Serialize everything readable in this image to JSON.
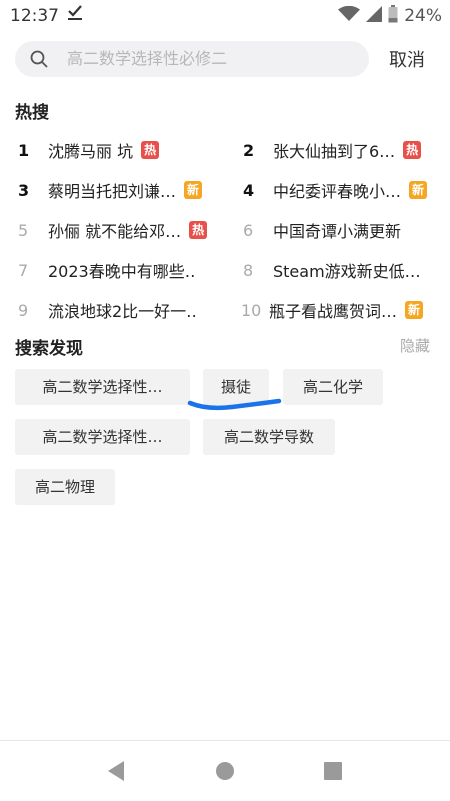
{
  "status_bar": {
    "time": "12:37",
    "battery_percent": "24%",
    "icons": [
      "download-done-icon",
      "wifi-icon",
      "signal-icon",
      "battery-icon"
    ]
  },
  "search": {
    "placeholder": "高二数学选择性必修二",
    "cancel_label": "取消"
  },
  "hot": {
    "title": "热搜",
    "items": [
      {
        "rank": "1",
        "text": "沈腾马丽 坑",
        "badge": "热"
      },
      {
        "rank": "2",
        "text": "张大仙抽到了6…",
        "badge": "热"
      },
      {
        "rank": "3",
        "text": "蔡明当托把刘谦…",
        "badge": "新"
      },
      {
        "rank": "4",
        "text": "中纪委评春晚小…",
        "badge": "新"
      },
      {
        "rank": "5",
        "text": "孙俪 就不能给邓…",
        "badge": "热"
      },
      {
        "rank": "6",
        "text": "中国奇谭小满更新",
        "badge": ""
      },
      {
        "rank": "7",
        "text": "2023春晚中有哪些…",
        "badge": ""
      },
      {
        "rank": "8",
        "text": "Steam游戏新史低…",
        "badge": ""
      },
      {
        "rank": "9",
        "text": "流浪地球2比一好一…",
        "badge": ""
      },
      {
        "rank": "10",
        "text": "瓶子看战鹰贺词…",
        "badge": "新"
      }
    ],
    "badge_colors": {
      "热": "#e8514a",
      "新": "#f5a623"
    }
  },
  "discover": {
    "title": "搜索发现",
    "hide_label": "隐藏",
    "chips": [
      "高二数学选择性…",
      "摄徒",
      "高二化学",
      "高二数学选择性…",
      "高二数学导数",
      "高二物理"
    ],
    "underline_color": "#1a73e8"
  }
}
